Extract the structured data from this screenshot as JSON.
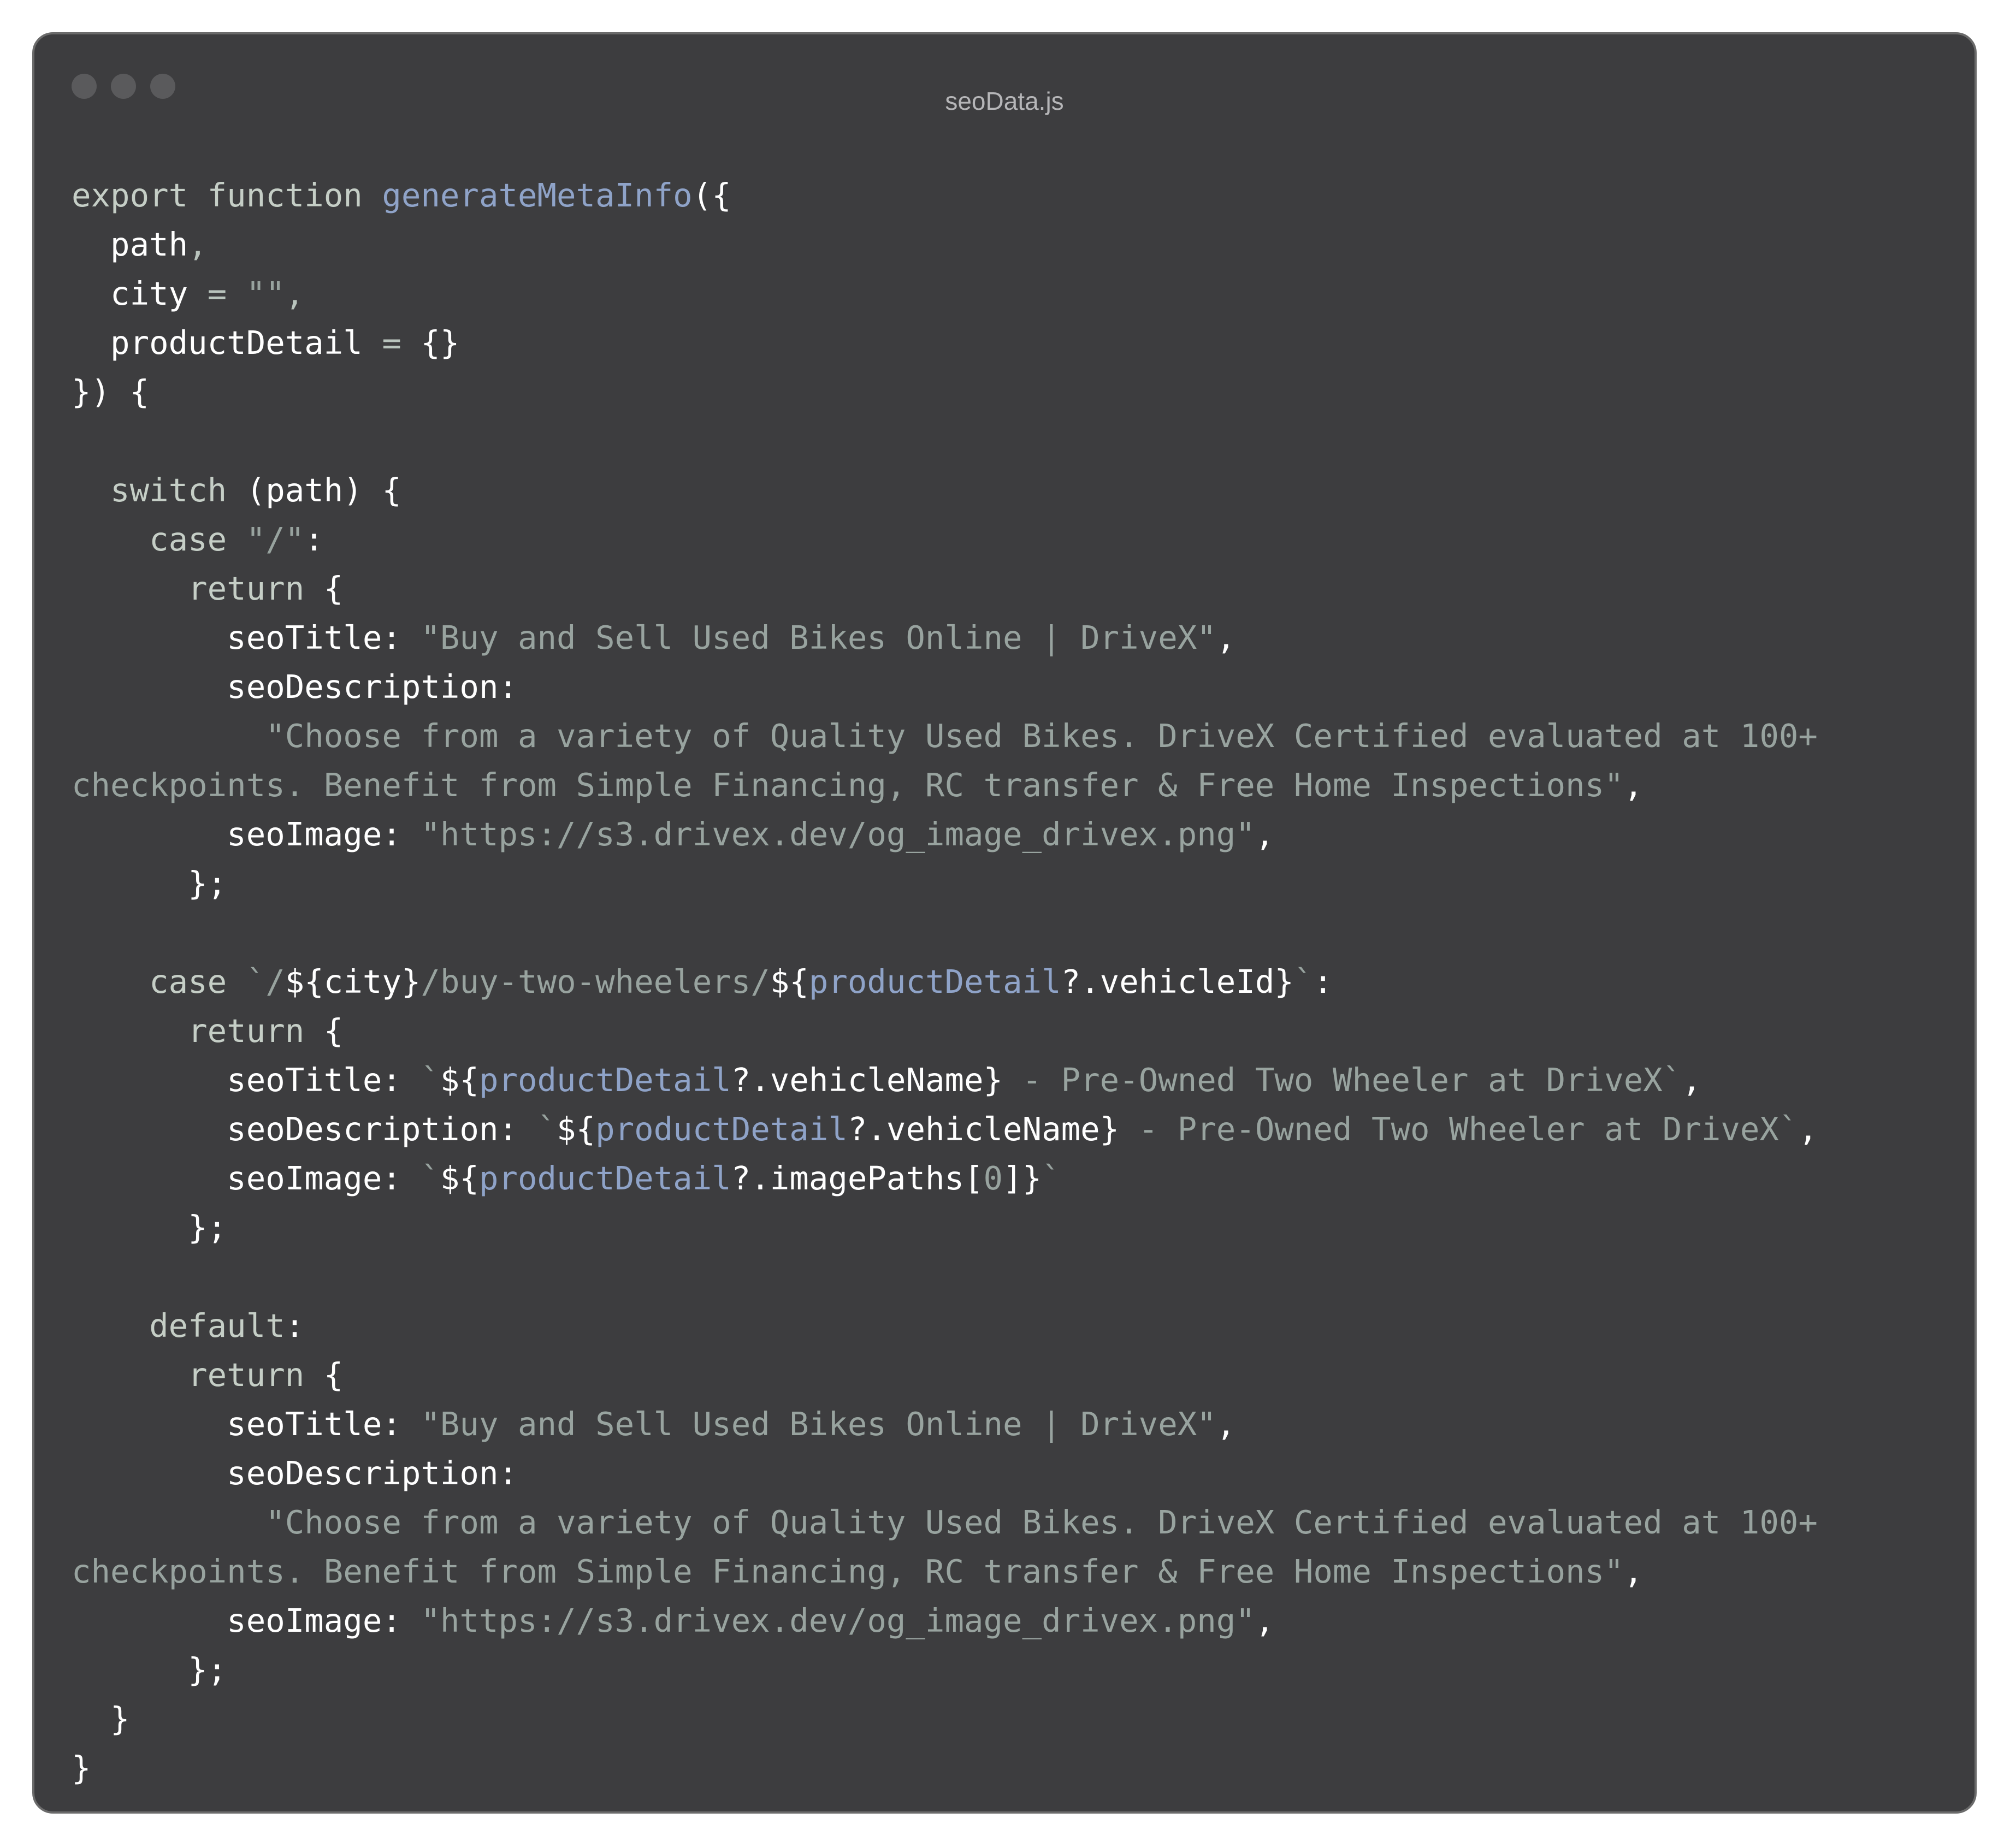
{
  "window": {
    "title": "seoData.js"
  },
  "code": {
    "lines": [
      [
        {
          "t": "kw",
          "s": "export function "
        },
        {
          "t": "fn",
          "s": "generateMetaInfo"
        },
        {
          "t": "punc",
          "s": "({"
        }
      ],
      [
        {
          "t": "id",
          "s": "  path"
        },
        {
          "t": "op",
          "s": ","
        }
      ],
      [
        {
          "t": "id",
          "s": "  city"
        },
        {
          "t": "op",
          "s": " = "
        },
        {
          "t": "str",
          "s": "\"\""
        },
        {
          "t": "op",
          "s": ","
        }
      ],
      [
        {
          "t": "id",
          "s": "  productDetail"
        },
        {
          "t": "op",
          "s": " = "
        },
        {
          "t": "punc",
          "s": "{}"
        }
      ],
      [
        {
          "t": "punc",
          "s": "}) {"
        }
      ],
      [],
      [
        {
          "t": "kw",
          "s": "  switch "
        },
        {
          "t": "punc",
          "s": "(path) {"
        }
      ],
      [
        {
          "t": "kw",
          "s": "    case "
        },
        {
          "t": "str",
          "s": "\"/\""
        },
        {
          "t": "punc",
          "s": ":"
        }
      ],
      [
        {
          "t": "kw",
          "s": "      return "
        },
        {
          "t": "punc",
          "s": "{"
        }
      ],
      [
        {
          "t": "id",
          "s": "        seoTitle"
        },
        {
          "t": "punc",
          "s": ": "
        },
        {
          "t": "str",
          "s": "\"Buy and Sell Used Bikes Online | DriveX\""
        },
        {
          "t": "punc",
          "s": ","
        }
      ],
      [
        {
          "t": "id",
          "s": "        seoDescription"
        },
        {
          "t": "punc",
          "s": ":"
        }
      ],
      [
        {
          "t": "str",
          "s": "          \"Choose from a variety of Quality Used Bikes. DriveX Certified evaluated at 100+"
        }
      ],
      [
        {
          "t": "str",
          "s": "checkpoints. Benefit from Simple Financing, RC transfer & Free Home Inspections\""
        },
        {
          "t": "punc",
          "s": ","
        }
      ],
      [
        {
          "t": "id",
          "s": "        seoImage"
        },
        {
          "t": "punc",
          "s": ": "
        },
        {
          "t": "str",
          "s": "\"https://s3.drivex.dev/og_image_drivex.png\""
        },
        {
          "t": "punc",
          "s": ","
        }
      ],
      [
        {
          "t": "punc",
          "s": "      };"
        }
      ],
      [],
      [
        {
          "t": "kw",
          "s": "    case "
        },
        {
          "t": "str",
          "s": "`/"
        },
        {
          "t": "punc",
          "s": "${"
        },
        {
          "t": "id",
          "s": "city"
        },
        {
          "t": "punc",
          "s": "}"
        },
        {
          "t": "str",
          "s": "/buy-two-wheelers/"
        },
        {
          "t": "punc",
          "s": "${"
        },
        {
          "t": "fn",
          "s": "productDetail"
        },
        {
          "t": "id",
          "s": "?.vehicleId"
        },
        {
          "t": "punc",
          "s": "}"
        },
        {
          "t": "str",
          "s": "`"
        },
        {
          "t": "punc",
          "s": ":"
        }
      ],
      [
        {
          "t": "kw",
          "s": "      return "
        },
        {
          "t": "punc",
          "s": "{"
        }
      ],
      [
        {
          "t": "id",
          "s": "        seoTitle"
        },
        {
          "t": "punc",
          "s": ": "
        },
        {
          "t": "str",
          "s": "`"
        },
        {
          "t": "punc",
          "s": "${"
        },
        {
          "t": "fn",
          "s": "productDetail"
        },
        {
          "t": "id",
          "s": "?.vehicleName"
        },
        {
          "t": "punc",
          "s": "}"
        },
        {
          "t": "str",
          "s": " - Pre-Owned Two Wheeler at DriveX`"
        },
        {
          "t": "punc",
          "s": ","
        }
      ],
      [
        {
          "t": "id",
          "s": "        seoDescription"
        },
        {
          "t": "punc",
          "s": ": "
        },
        {
          "t": "str",
          "s": "`"
        },
        {
          "t": "punc",
          "s": "${"
        },
        {
          "t": "fn",
          "s": "productDetail"
        },
        {
          "t": "id",
          "s": "?.vehicleName"
        },
        {
          "t": "punc",
          "s": "}"
        },
        {
          "t": "str",
          "s": " - Pre-Owned Two Wheeler at DriveX`"
        },
        {
          "t": "punc",
          "s": ","
        }
      ],
      [
        {
          "t": "id",
          "s": "        seoImage"
        },
        {
          "t": "punc",
          "s": ": "
        },
        {
          "t": "str",
          "s": "`"
        },
        {
          "t": "punc",
          "s": "${"
        },
        {
          "t": "fn",
          "s": "productDetail"
        },
        {
          "t": "id",
          "s": "?.imagePaths["
        },
        {
          "t": "str",
          "s": "0"
        },
        {
          "t": "id",
          "s": "]"
        },
        {
          "t": "punc",
          "s": "}"
        },
        {
          "t": "str",
          "s": "`"
        }
      ],
      [
        {
          "t": "punc",
          "s": "      };"
        }
      ],
      [],
      [
        {
          "t": "kw",
          "s": "    default"
        },
        {
          "t": "punc",
          "s": ":"
        }
      ],
      [
        {
          "t": "kw",
          "s": "      return "
        },
        {
          "t": "punc",
          "s": "{"
        }
      ],
      [
        {
          "t": "id",
          "s": "        seoTitle"
        },
        {
          "t": "punc",
          "s": ": "
        },
        {
          "t": "str",
          "s": "\"Buy and Sell Used Bikes Online | DriveX\""
        },
        {
          "t": "punc",
          "s": ","
        }
      ],
      [
        {
          "t": "id",
          "s": "        seoDescription"
        },
        {
          "t": "punc",
          "s": ":"
        }
      ],
      [
        {
          "t": "str",
          "s": "          \"Choose from a variety of Quality Used Bikes. DriveX Certified evaluated at 100+"
        }
      ],
      [
        {
          "t": "str",
          "s": "checkpoints. Benefit from Simple Financing, RC transfer & Free Home Inspections\""
        },
        {
          "t": "punc",
          "s": ","
        }
      ],
      [
        {
          "t": "id",
          "s": "        seoImage"
        },
        {
          "t": "punc",
          "s": ": "
        },
        {
          "t": "str",
          "s": "\"https://s3.drivex.dev/og_image_drivex.png\""
        },
        {
          "t": "punc",
          "s": ","
        }
      ],
      [
        {
          "t": "punc",
          "s": "      };"
        }
      ],
      [
        {
          "t": "punc",
          "s": "  }"
        }
      ],
      [
        {
          "t": "punc",
          "s": "}"
        }
      ]
    ]
  },
  "colors": {
    "window_bg": "#3d3d3f",
    "keyword": "#c5cec6",
    "function": "#8fa3c8",
    "string": "#98a39f",
    "text": "#ffffff"
  }
}
